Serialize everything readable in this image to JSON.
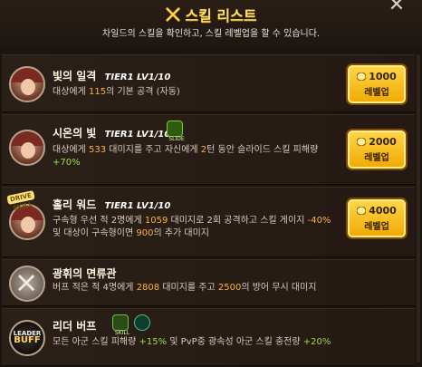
{
  "header": {
    "title": "스킬 리스트",
    "subtitle": "차일드의 스킬을 확인하고, 스킬 레벨업을 할 수 있습니다.",
    "close_icon": "close-icon",
    "title_icon": "crossed-swords-icon"
  },
  "skills": [
    {
      "name": "빛의 일격",
      "tier": "TIER1 LV1/10",
      "desc_parts": [
        "대상에게 ",
        "115",
        "의 기본 공격 (자동)"
      ],
      "upgrade": {
        "cost": "1000",
        "label": "레벨업"
      }
    },
    {
      "name": "시온의 빛",
      "tier": "TIER1 LV1/10",
      "badge": "SLIDE",
      "desc_parts": [
        "대상에게 ",
        "533",
        " 대미지를 주고 자신에게 ",
        "2",
        "턴 동안 슬라이드 스킬 피해량 ",
        "+70%"
      ],
      "upgrade": {
        "cost": "2000",
        "label": "레벨업"
      }
    },
    {
      "name": "홀리 워드",
      "tier": "TIER1 LV1/10",
      "corner_tag": "DRIVE SKILL",
      "desc_parts": [
        "구속형 우선 적 2명에게 ",
        "1059",
        " 대미지로 2회 공격하고 스킬 게이지 ",
        "-40%",
        " 및 대상이 구속형이면 ",
        "900",
        "의 추가 대미지"
      ],
      "upgrade": {
        "cost": "4000",
        "label": "레벨업"
      }
    },
    {
      "name": "광휘의 면류관",
      "desc_parts": [
        "버프 적은 적 4명에게 ",
        "2808",
        " 대미지를 주고 ",
        "2500",
        "의 방어 무시 대미지"
      ]
    },
    {
      "name": "리더 버프",
      "badge": "SKILL",
      "leader_icon": {
        "top": "LEADER",
        "bottom": "BUFF"
      },
      "desc_parts": [
        "모든 아군 스킬 피해량 ",
        "+15%",
        " 및 PvP중 광속성 아군 스킬 충전량 ",
        "+20%"
      ]
    }
  ],
  "colors": {
    "accent": "#ffe066",
    "highlight_orange": "#ffb13b",
    "highlight_green": "#9bdc4a",
    "button": "#f0a800"
  }
}
